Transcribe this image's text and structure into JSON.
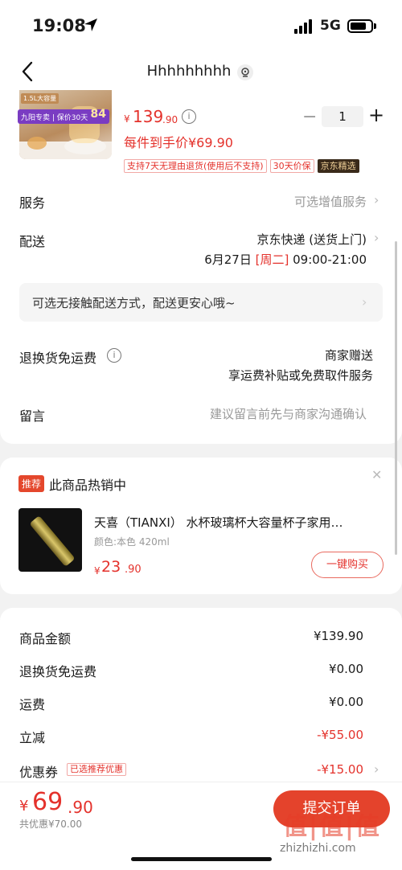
{
  "status_bar": {
    "time": "19:08",
    "network": "5G"
  },
  "header": {
    "title": "Hhhhhhhhh"
  },
  "product": {
    "image_tag_capacity": "1.5L大容量",
    "image_tag_promo": "九阳专卖 | 保价30天",
    "image_tag_price": "84",
    "price_symbol": "¥",
    "price_int": "139",
    "price_dec": ".90",
    "quantity": "1",
    "each_price": "每件到手价¥69.90",
    "tags": [
      "支持7天无理由退货(使用后不支持)",
      "30天价保",
      "京东精选"
    ]
  },
  "rows": {
    "service_label": "服务",
    "service_value": "可选增值服务",
    "delivery_label": "配送",
    "delivery_method": "京东快递 (送货上门)",
    "delivery_date": "6月27日",
    "delivery_weekday": "[周二]",
    "delivery_time": "09:00-21:00",
    "notice": "可选无接触配送方式，配送更安心哦~",
    "return_label": "退换货免运费",
    "return_value1": "商家赠送",
    "return_value2": "享运费补贴或免费取件服务",
    "message_label": "留言",
    "message_placeholder": "建议留言前先与商家沟通确认"
  },
  "recommend": {
    "badge": "推荐",
    "title": "此商品热销中",
    "name": "天喜（TIANXI） 水杯玻璃杯大容量杯子家用…",
    "spec": "颜色:本色 420ml",
    "price_symbol": "¥",
    "price_int": "23",
    "price_dec": ".90",
    "buy_label": "一键购买"
  },
  "summary": [
    {
      "label": "商品金额",
      "value": "¥139.90"
    },
    {
      "label": "退换货免运费",
      "value": "¥0.00"
    },
    {
      "label": "运费",
      "value": "¥0.00"
    },
    {
      "label": "立减",
      "value": "-¥55.00"
    },
    {
      "label": "优惠券",
      "value": "-¥15.00"
    }
  ],
  "coupon_tag": "已选推荐优惠",
  "footer": {
    "total_symbol": "¥",
    "total_int": "69",
    "total_dec": ".90",
    "saved": "共优惠¥70.00",
    "submit_label": "提交订单"
  },
  "watermark": {
    "logo": "值|值|值",
    "url": "zhizhizhi.com"
  },
  "colors": {
    "accent": "#e4322c",
    "background": "#f2f2f2"
  }
}
